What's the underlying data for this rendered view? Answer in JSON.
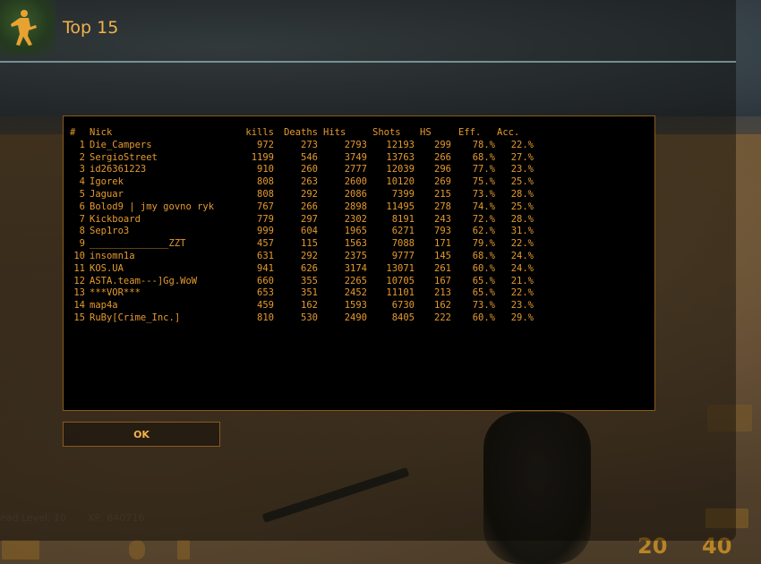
{
  "window": {
    "title": "Top 15"
  },
  "table": {
    "headers": [
      "#",
      "Nick",
      "kills",
      "Deaths",
      "Hits",
      "Shots",
      "HS",
      "Eff.",
      "Acc."
    ],
    "rows": [
      [
        "1",
        "Die_Campers",
        "972",
        "273",
        "2793",
        "12193",
        "299",
        "78.%",
        "22.%"
      ],
      [
        "2",
        "SergioStreet",
        "1199",
        "546",
        "3749",
        "13763",
        "266",
        "68.%",
        "27.%"
      ],
      [
        "3",
        "id26361223",
        "910",
        "260",
        "2777",
        "12039",
        "296",
        "77.%",
        "23.%"
      ],
      [
        "4",
        "Igorek",
        "808",
        "263",
        "2600",
        "10120",
        "269",
        "75.%",
        "25.%"
      ],
      [
        "5",
        "Jaguar",
        "808",
        "292",
        "2086",
        "7399",
        "215",
        "73.%",
        "28.%"
      ],
      [
        "6",
        "Bolod9 | jmy govno ryk",
        "767",
        "266",
        "2898",
        "11495",
        "278",
        "74.%",
        "25.%"
      ],
      [
        "7",
        "Kickboard",
        "779",
        "297",
        "2302",
        "8191",
        "243",
        "72.%",
        "28.%"
      ],
      [
        "8",
        "Sep1ro3",
        "999",
        "604",
        "1965",
        "6271",
        "793",
        "62.%",
        "31.%"
      ],
      [
        "9",
        "______________ZZT",
        "457",
        "115",
        "1563",
        "7088",
        "171",
        "79.%",
        "22.%"
      ],
      [
        "10",
        "insomn1a",
        "631",
        "292",
        "2375",
        "9777",
        "145",
        "68.%",
        "24.%"
      ],
      [
        "11",
        "KOS.UA",
        "941",
        "626",
        "3174",
        "13071",
        "261",
        "60.%",
        "24.%"
      ],
      [
        "12",
        "ASTA.team---]Gg.WoW",
        "660",
        "355",
        "2265",
        "10705",
        "167",
        "65.%",
        "21.%"
      ],
      [
        "13",
        "***VOR***",
        "653",
        "351",
        "2452",
        "11101",
        "213",
        "65.%",
        "22.%"
      ],
      [
        "14",
        "map4a",
        "459",
        "162",
        "1593",
        "6730",
        "162",
        "73.%",
        "23.%"
      ],
      [
        "15",
        "RuBy[Crime_Inc.]",
        "810",
        "530",
        "2490",
        "8405",
        "222",
        "60.%",
        "29.%"
      ]
    ]
  },
  "buttons": {
    "ok": "OK"
  },
  "hud": {
    "level": "ead Level: 10",
    "xp": "XP: 640716",
    "health_icon": "cross-icon",
    "money": "20",
    "ammo": "40"
  },
  "colors": {
    "accent": "#f2b24a",
    "table_text": "#e49a2e",
    "border": "#8a5a1c"
  }
}
